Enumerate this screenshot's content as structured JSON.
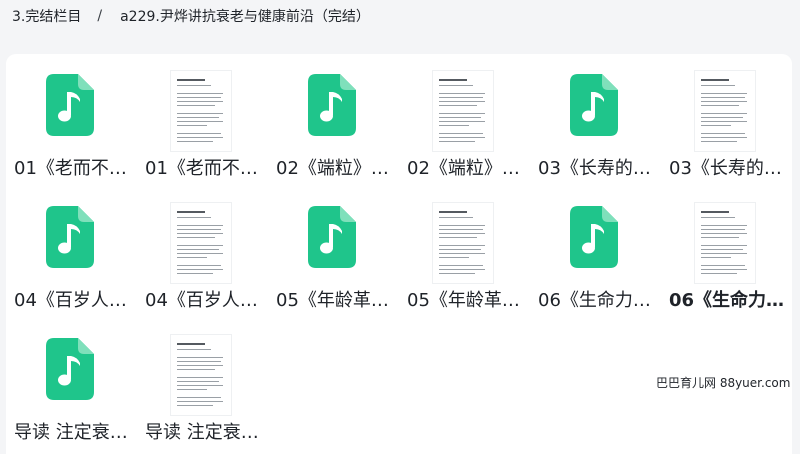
{
  "breadcrumb": {
    "parent": "3.完结栏目",
    "separator": "/",
    "current": "a229.尹烨讲抗衰老与健康前沿（完结）"
  },
  "colors": {
    "audio_icon": "#1fc58b",
    "panel_bg": "#ffffff",
    "page_bg": "#f4f5f7"
  },
  "files": [
    {
      "name": "01《老而不…",
      "type": "audio",
      "icon": "music-note-file-icon"
    },
    {
      "name": "01《老而不…",
      "type": "document",
      "icon": "document-thumbnail"
    },
    {
      "name": "02《端粒》…",
      "type": "audio",
      "icon": "music-note-file-icon"
    },
    {
      "name": "02《端粒》…",
      "type": "document",
      "icon": "document-thumbnail"
    },
    {
      "name": "03《长寿的…",
      "type": "audio",
      "icon": "music-note-file-icon"
    },
    {
      "name": "03《长寿的…",
      "type": "document",
      "icon": "document-thumbnail"
    },
    {
      "name": "04《百岁人…",
      "type": "audio",
      "icon": "music-note-file-icon"
    },
    {
      "name": "04《百岁人…",
      "type": "document",
      "icon": "document-thumbnail"
    },
    {
      "name": "05《年龄革…",
      "type": "audio",
      "icon": "music-note-file-icon"
    },
    {
      "name": "05《年龄革…",
      "type": "document",
      "icon": "document-thumbnail"
    },
    {
      "name": "06《生命力…",
      "type": "audio",
      "icon": "music-note-file-icon"
    },
    {
      "name": "06《生命力…",
      "type": "document",
      "icon": "document-thumbnail"
    },
    {
      "name": "导读 注定衰…",
      "type": "audio",
      "icon": "music-note-file-icon"
    },
    {
      "name": "导读 注定衰…",
      "type": "document",
      "icon": "document-thumbnail"
    }
  ],
  "watermark": "巴巴育儿网 88yuer.com"
}
